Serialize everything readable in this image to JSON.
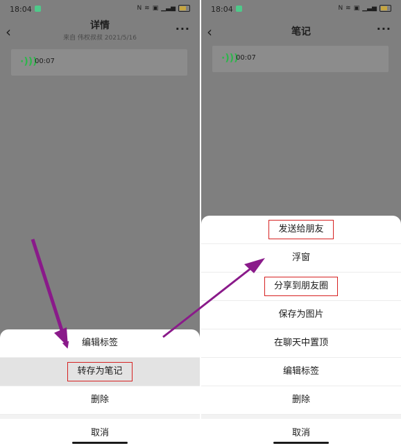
{
  "left_screen": {
    "status_bar": {
      "time": "18:04",
      "icons": [
        "nfc-icon",
        "wifi-icon",
        "hd-icon",
        "signal-icon",
        "battery-icon"
      ]
    },
    "nav": {
      "title": "详情",
      "subtitle": "来自 伟权叔叔 2021/5/16"
    },
    "voice_note": {
      "duration": "00:07"
    },
    "sheet": {
      "items": [
        "编辑标签",
        "转存为笔记",
        "删除"
      ],
      "cancel": "取消"
    }
  },
  "right_screen": {
    "status_bar": {
      "time": "18:04"
    },
    "nav": {
      "title": "笔记"
    },
    "voice_note": {
      "duration": "00:07"
    },
    "sheet": {
      "items": [
        "发送给朋友",
        "浮窗",
        "分享到朋友圈",
        "保存为图片",
        "在聊天中置顶",
        "编辑标签",
        "删除"
      ],
      "cancel": "取消"
    }
  },
  "colors": {
    "highlight_box": "#d62020",
    "arrow": "#8a1a8a",
    "voice_wave": "#2db64b",
    "overlay": "#7f7f7f"
  }
}
